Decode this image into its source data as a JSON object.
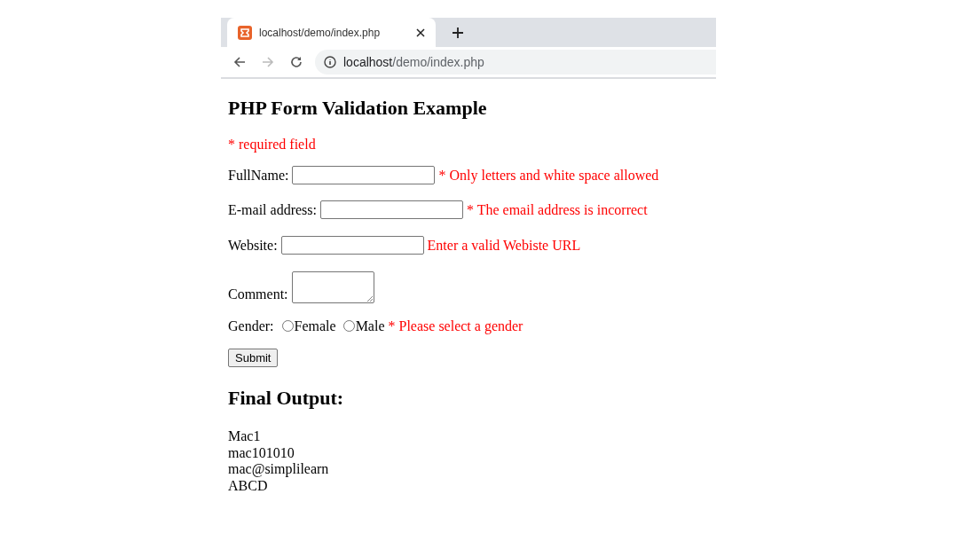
{
  "browser": {
    "tab": {
      "title": "localhost/demo/index.php",
      "selected": true
    },
    "address": {
      "host": "localhost",
      "path": "/demo/index.php"
    }
  },
  "page": {
    "title": "PHP Form Validation Example",
    "required_note": "* required field",
    "fields": [
      {
        "kind": "text",
        "label": "FullName:",
        "error": "* Only letters and white space allowed"
      },
      {
        "kind": "text",
        "label": "E-mail address:",
        "error": "* The email address is incorrect"
      },
      {
        "kind": "text",
        "label": "Website:",
        "error": "Enter a valid Webiste URL"
      },
      {
        "kind": "textarea",
        "label": "Comment:"
      },
      {
        "kind": "radio",
        "label": "Gender:",
        "options": [
          {
            "label": "Female",
            "selected": false
          },
          {
            "label": "Male",
            "selected": false
          }
        ],
        "error": "* Please select a gender"
      }
    ],
    "submit": "Submit",
    "output_title": "Final Output:",
    "output_lines": [
      "Mac1",
      "mac101010",
      "mac@simplilearn",
      "ABCD"
    ]
  }
}
